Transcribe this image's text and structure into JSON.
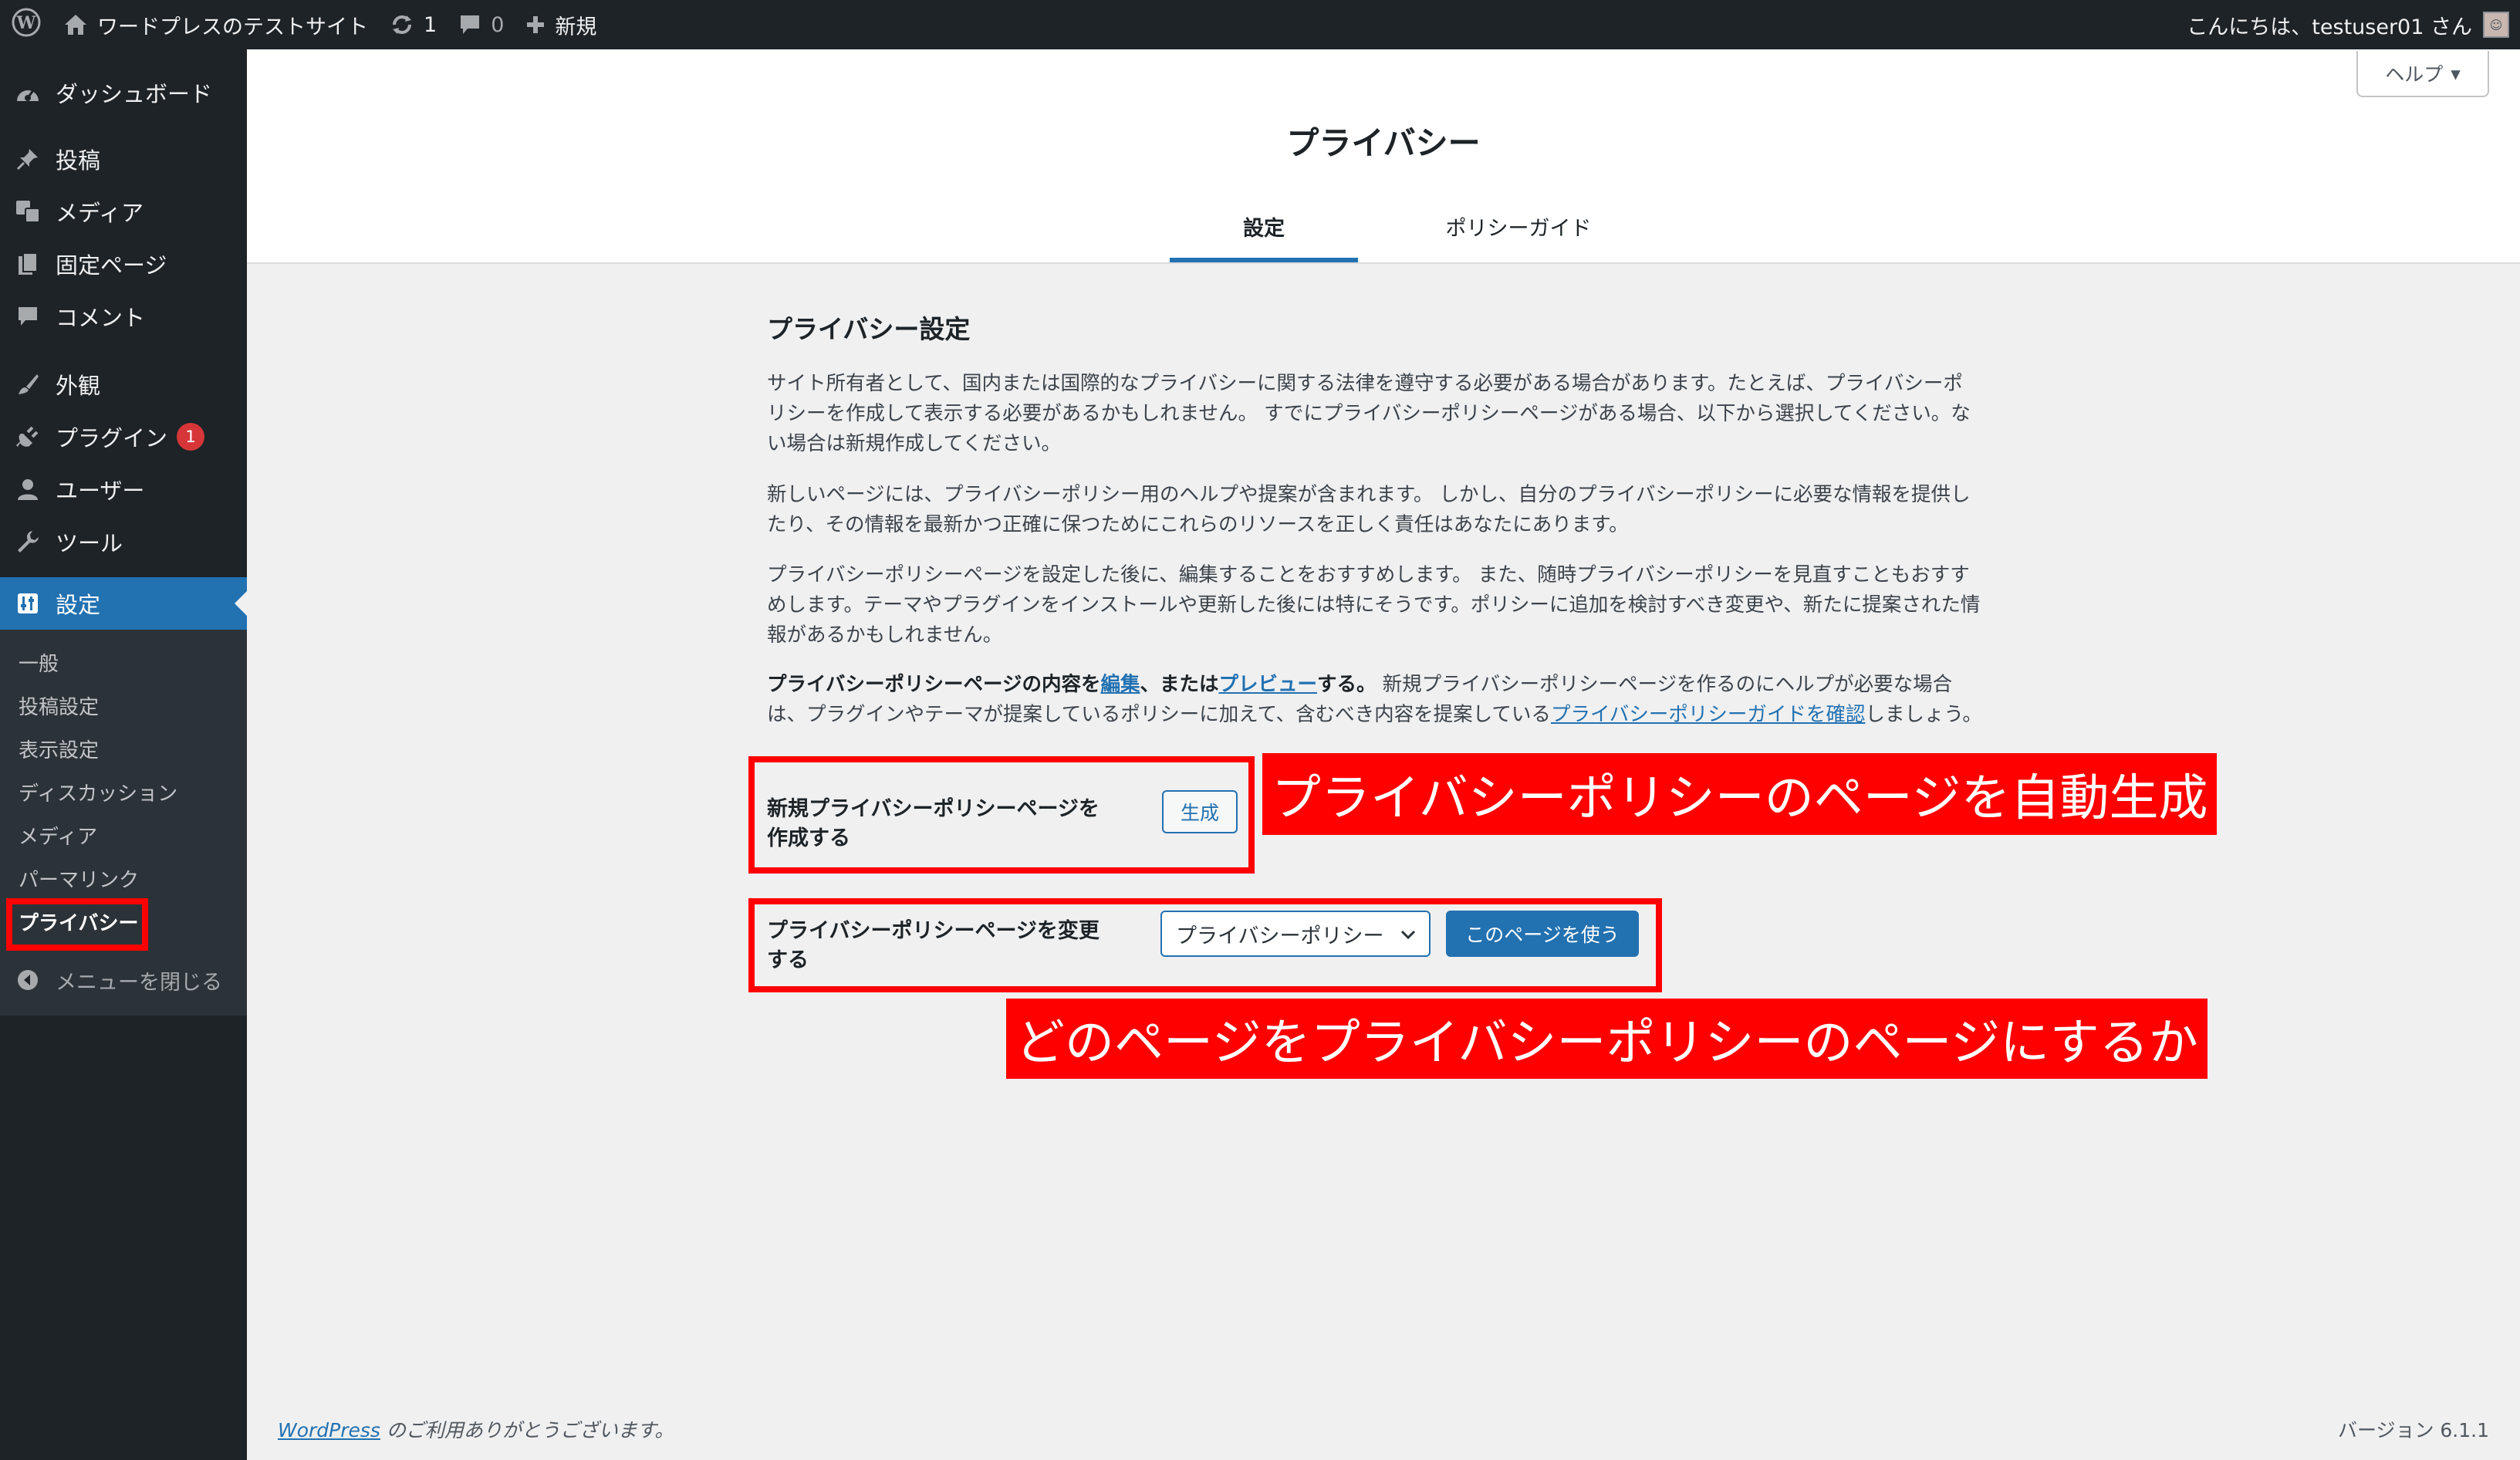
{
  "adminbar": {
    "site_name": "ワードプレスのテストサイト",
    "updates_count": "1",
    "comments_count": "0",
    "new_label": "新規",
    "greeting": "こんにちは、testuser01 さん"
  },
  "sidebar": {
    "items": [
      {
        "label": "ダッシュボード"
      },
      {
        "label": "投稿"
      },
      {
        "label": "メディア"
      },
      {
        "label": "固定ページ"
      },
      {
        "label": "コメント"
      },
      {
        "label": "外観"
      },
      {
        "label": "プラグイン",
        "badge": "1"
      },
      {
        "label": "ユーザー"
      },
      {
        "label": "ツール"
      },
      {
        "label": "設定"
      }
    ],
    "submenu": [
      "一般",
      "投稿設定",
      "表示設定",
      "ディスカッション",
      "メディア",
      "パーマリンク",
      "プライバシー"
    ],
    "collapse_label": "メニューを閉じる"
  },
  "header": {
    "help_label": "ヘルプ",
    "title": "プライバシー",
    "tabs": [
      {
        "label": "設定"
      },
      {
        "label": "ポリシーガイド"
      }
    ]
  },
  "main": {
    "section_title": "プライバシー設定",
    "para1_lines": [
      "サイト所有者として、国内または国際的なプライバシーに関する法律を遵守する必要がある場合があります。たとえば、プライバシーポ",
      "リシーを作成して表示する必要があるかもしれません。 すでにプライバシーポリシーページがある場合、以下から選択してください。な",
      "い場合は新規作成してください。"
    ],
    "para2_lines": [
      "新しいページには、プライバシーポリシー用のヘルプや提案が含まれます。 しかし、自分のプライバシーポリシーに必要な情報を提供し",
      "たり、その情報を最新かつ正確に保つためにこれらのリソースを正しく責任はあなたにあります。"
    ],
    "para3_lines": [
      "プライバシーポリシーページを設定した後に、編集することをおすすめします。 また、随時プライバシーポリシーを見直すこともおすす",
      "めします。テーマやプラグインをインストールや更新した後には特にそうです。ポリシーに追加を検討すべき変更や、新たに提案された情",
      "報があるかもしれません。"
    ],
    "para4": {
      "bold_a": "プライバシーポリシーページの内容を",
      "link_edit": "編集",
      "bold_b": "、または",
      "link_preview": "プレビュー",
      "bold_c": "する。",
      "text_a": " 新規プライバシーポリシーページを作るのにヘルプが必要な場合",
      "text_b": "は、プラグインやテーマが提案しているポリシーに加えて、含むべき内容を提案している",
      "link_guide": "プライバシーポリシーガイドを確認",
      "text_c": "しましょう。"
    },
    "create_label_line1": "新規プライバシーポリシーページを",
    "create_label_line2": "作成する",
    "create_button": "生成",
    "change_label_line1": "プライバシーポリシーページを変更",
    "change_label_line2": "する",
    "select_value": "プライバシーポリシー",
    "use_page_button": "このページを使う"
  },
  "annotations": {
    "label1": "プライバシーポリシーのページを自動生成",
    "label2": "どのページをプライバシーポリシーのページにするか",
    "color": "#ff0000"
  },
  "footer": {
    "link": "WordPress",
    "text": " のご利用ありがとうございます。",
    "version": "バージョン 6.1.1"
  },
  "colors": {
    "accent": "#2271b1",
    "adminbar": "#1d2327",
    "badge": "#d63638"
  }
}
